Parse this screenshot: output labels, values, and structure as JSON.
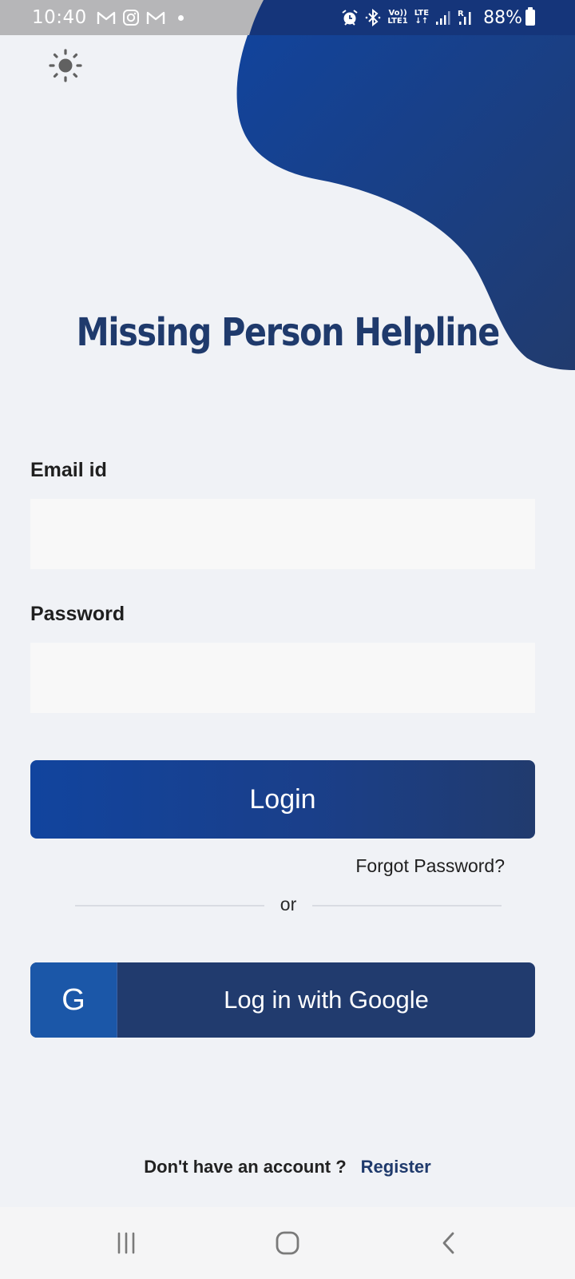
{
  "status_bar": {
    "time": "10:40",
    "left_icons": [
      "gmail-icon",
      "instagram-icon",
      "gmail-icon",
      "notification-dot"
    ],
    "right_icons": [
      "alarm-icon",
      "bluetooth-icon",
      "volte-icon",
      "lte-data-icon",
      "signal-icon",
      "roaming-signal-icon"
    ],
    "volte_top": "Vo))",
    "volte_bottom": "LTE1",
    "lte_top": "LTE",
    "lte_bottom": "↓↑",
    "roaming_label": "R",
    "battery_percent": "88%",
    "battery_level": 0.88
  },
  "theme_toggle": {
    "icon": "sun-icon"
  },
  "app": {
    "title": "Missing Person Helpline",
    "brand_color": "#1f3a6c",
    "accent_color": "#11449e"
  },
  "form": {
    "email": {
      "label": "Email id",
      "value": "",
      "placeholder": ""
    },
    "password": {
      "label": "Password",
      "value": "",
      "placeholder": ""
    },
    "login_button": "Login",
    "forgot_password": "Forgot Password?",
    "divider_text": "or",
    "google_button": {
      "icon_letter": "G",
      "label": "Log in with Google"
    }
  },
  "footer": {
    "prompt": "Don't have an account ?",
    "register_link": "Register"
  },
  "nav_bar": {
    "buttons": [
      "recents-icon",
      "home-icon",
      "back-icon"
    ]
  }
}
